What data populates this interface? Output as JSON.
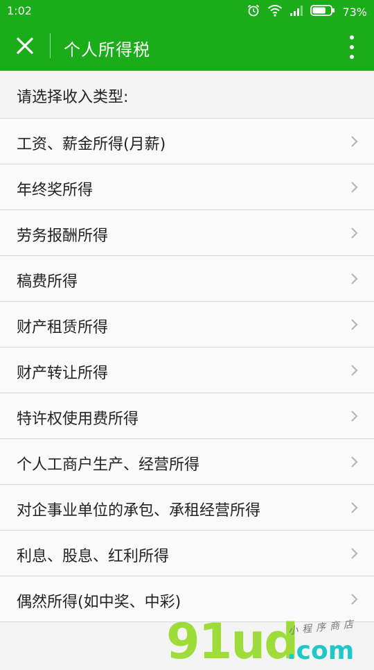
{
  "status_bar": {
    "time": "1:02",
    "battery_percent": "73%",
    "icons": [
      "alarm-icon",
      "wifi-icon",
      "signal-icon",
      "battery-icon"
    ],
    "battery_level": 0.73
  },
  "title_bar": {
    "title": "个人所得税",
    "close_icon": "close-icon",
    "menu_icon": "more-vertical-icon",
    "background_color": "#1aad19"
  },
  "section": {
    "header": "请选择收入类型:"
  },
  "income_types": [
    {
      "label": "工资、薪金所得(月薪)"
    },
    {
      "label": "年终奖所得"
    },
    {
      "label": "劳务报酬所得"
    },
    {
      "label": "稿费所得"
    },
    {
      "label": "财产租赁所得"
    },
    {
      "label": "财产转让所得"
    },
    {
      "label": "特许权使用费所得"
    },
    {
      "label": "个人工商户生产、经营所得"
    },
    {
      "label": "对企事业单位的承包、承租经营所得"
    },
    {
      "label": "利息、股息、红利所得"
    },
    {
      "label": "偶然所得(如中奖、中彩)"
    }
  ],
  "watermark": {
    "brand": "91ud",
    "suffix": ".com",
    "tagline": "小程序商店"
  }
}
